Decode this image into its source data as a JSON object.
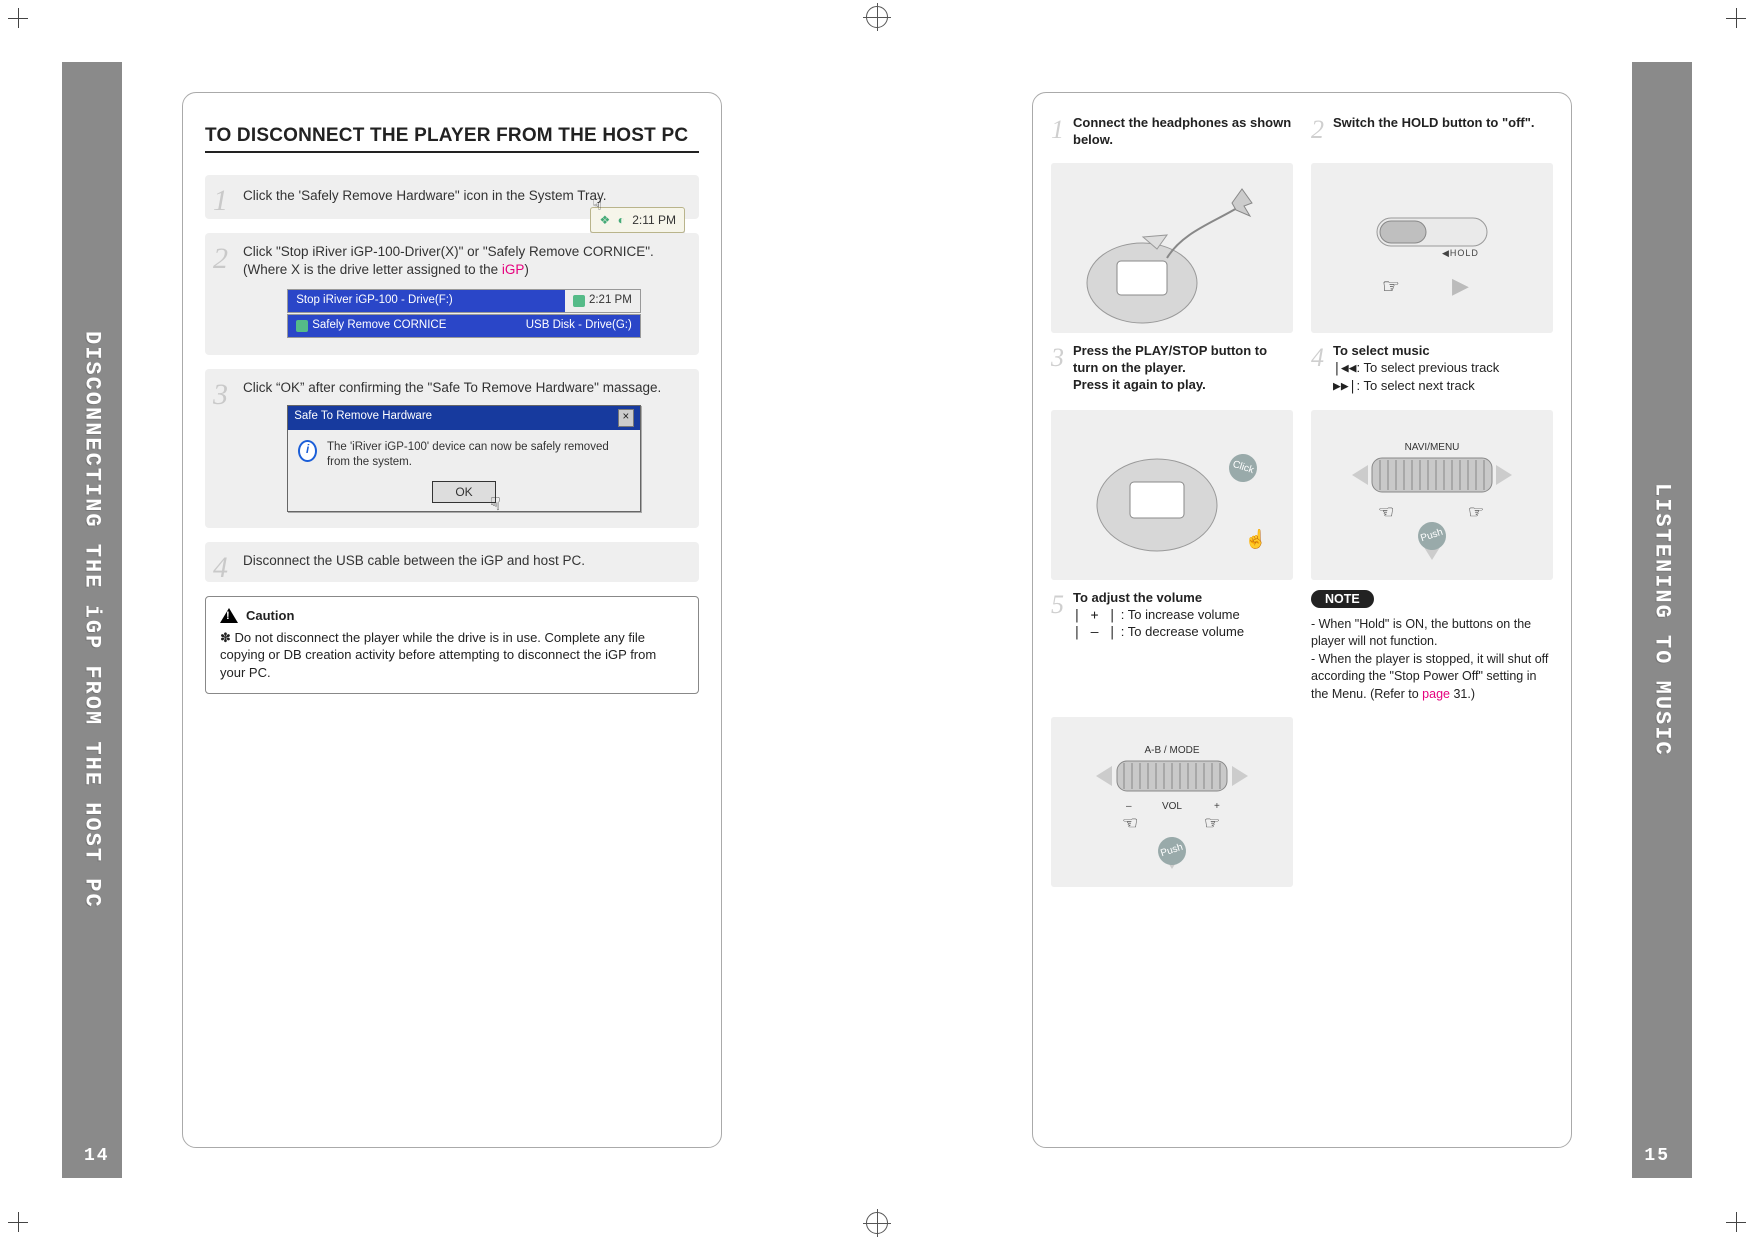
{
  "left_tab": "DISCONNECTING THE iGP FROM THE HOST PC",
  "right_tab": "LISTENING TO MUSIC",
  "page_left_num": "14",
  "page_right_num": "15",
  "left": {
    "title": "TO DISCONNECT THE PLAYER FROM THE HOST PC",
    "step1_pre": "Click the 'Safely Remove Hardware\" icon in the System Tray.",
    "tray_time": "2:11 PM",
    "step2_a": "Click \"Stop iRiver iGP-100-Driver(X)\" or \"Safely Remove CORNICE\".",
    "step2_b_pre": "(Where X is the drive letter assigned to the ",
    "step2_b_igp": "iGP",
    "step2_b_post": ")",
    "menu_row1": "Stop iRiver iGP-100 - Drive(F:)",
    "menu_row1_time": "2:21 PM",
    "menu_row2_a": "Safely Remove  CORNICE",
    "menu_row2_b": "USB Disk - Drive(G:)",
    "step3": "Click “OK” after confirming the \"Safe To Remove Hardware\" massage.",
    "dialog_title": "Safe To Remove Hardware",
    "dialog_body": "The 'iRiver iGP-100' device can now be safely removed from the system.",
    "dialog_ok": "OK",
    "step4": "Disconnect the USB cable between the iGP and host PC.",
    "caution_head": "Caution",
    "caution_body": "Do not disconnect the player while the drive is in use. Complete any file copying or DB creation activity before attempting to disconnect the iGP from your PC."
  },
  "right": {
    "s1": "Connect the headphones as shown below.",
    "s2": "Switch the HOLD button to \"off\".",
    "hold_label": "◀HOLD",
    "s3a": "Press the PLAY/STOP button to turn on the player.",
    "s3b": "Press it again to play.",
    "s4_head": "To select music",
    "s4_prev": ": To select previous track",
    "s4_next": ": To select next track",
    "navi_label": "NAVI/MENU",
    "s5_head": "To adjust the volume",
    "s5_up": " : To increase volume",
    "s5_dn": " : To decrease volume",
    "vol_label_top": "A-B / MODE",
    "vol_label_mid": "VOL",
    "note_label": "NOTE",
    "note_1": "- When \"Hold\" is ON, the buttons on the player will not function.",
    "note_2a": "- When the player is stopped, it will shut off according the \"Stop Power Off\" setting in the Menu. (Refer to ",
    "note_2_pg": "page",
    "note_2b": " 31.)",
    "push": "Push",
    "click": "Click"
  }
}
